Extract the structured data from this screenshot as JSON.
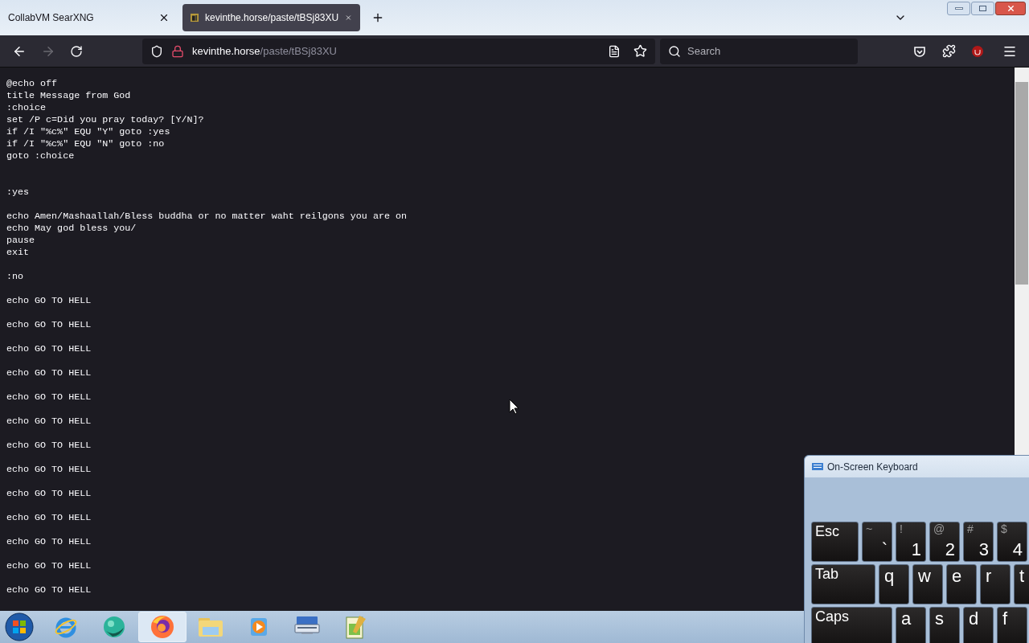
{
  "tabs": [
    {
      "title": "CollabVM SearXNG",
      "selected": false
    },
    {
      "title": "kevinthe.horse/paste/tBSj83XU",
      "selected": true
    }
  ],
  "address": {
    "domain": "kevinthe.horse",
    "path": "/paste/tBSj83XU"
  },
  "search": {
    "placeholder": "Search"
  },
  "code_lines": [
    {
      "kind": "text",
      "text": "@echo off"
    },
    {
      "kind": "text",
      "text": "title Message from God"
    },
    {
      "kind": "text",
      "text": ":choice"
    },
    {
      "kind": "text",
      "text": "set /P c=Did you pray today? [Y/N]?"
    },
    {
      "kind": "text",
      "text": "if /I \"%c%\" EQU \"Y\" goto :yes"
    },
    {
      "kind": "text",
      "text": "if /I \"%c%\" EQU \"N\" goto :no"
    },
    {
      "kind": "text",
      "text": "goto :choice"
    },
    {
      "kind": "blank"
    },
    {
      "kind": "blank"
    },
    {
      "kind": "text",
      "text": ":yes"
    },
    {
      "kind": "blank"
    },
    {
      "kind": "text",
      "text": "echo Amen/Mashaallah/Bless buddha or no matter waht reilgons you are on"
    },
    {
      "kind": "text",
      "text": "echo May god bless you/"
    },
    {
      "kind": "text",
      "text": "pause"
    },
    {
      "kind": "text",
      "text": "exit"
    },
    {
      "kind": "blank"
    },
    {
      "kind": "text",
      "text": ":no"
    },
    {
      "kind": "blank"
    },
    {
      "kind": "text",
      "text": "echo GO TO HELL"
    },
    {
      "kind": "blank"
    },
    {
      "kind": "text",
      "text": "echo GO TO HELL"
    },
    {
      "kind": "blank"
    },
    {
      "kind": "text",
      "text": "echo GO TO HELL"
    },
    {
      "kind": "blank"
    },
    {
      "kind": "text",
      "text": "echo GO TO HELL"
    },
    {
      "kind": "blank"
    },
    {
      "kind": "text",
      "text": "echo GO TO HELL"
    },
    {
      "kind": "blank"
    },
    {
      "kind": "text",
      "text": "echo GO TO HELL"
    },
    {
      "kind": "blank"
    },
    {
      "kind": "text",
      "text": "echo GO TO HELL"
    },
    {
      "kind": "blank"
    },
    {
      "kind": "text",
      "text": "echo GO TO HELL"
    },
    {
      "kind": "blank"
    },
    {
      "kind": "text",
      "text": "echo GO TO HELL"
    },
    {
      "kind": "blank"
    },
    {
      "kind": "text",
      "text": "echo GO TO HELL"
    },
    {
      "kind": "blank"
    },
    {
      "kind": "text",
      "text": "echo GO TO HELL"
    },
    {
      "kind": "blank"
    },
    {
      "kind": "text",
      "text": "echo GO TO HELL"
    },
    {
      "kind": "blank"
    },
    {
      "kind": "text",
      "text": "echo GO TO HELL"
    }
  ],
  "keyboard": {
    "title": "On-Screen Keyboard",
    "rows": [
      [
        {
          "label": "Esc",
          "kind": "wide"
        },
        {
          "label": "`",
          "shift": "~",
          "kind": "normal"
        },
        {
          "label": "1",
          "shift": "!",
          "kind": "normal"
        },
        {
          "label": "2",
          "shift": "@",
          "kind": "normal"
        },
        {
          "label": "3",
          "shift": "#",
          "kind": "normal"
        },
        {
          "label": "4",
          "shift": "$",
          "kind": "normal"
        }
      ],
      [
        {
          "label": "Tab",
          "kind": "wide"
        },
        {
          "label": "q",
          "kind": "normal"
        },
        {
          "label": "w",
          "kind": "normal"
        },
        {
          "label": "e",
          "kind": "normal"
        },
        {
          "label": "r",
          "kind": "normal"
        },
        {
          "label": "t",
          "kind": "normal"
        }
      ],
      [
        {
          "label": "Caps",
          "kind": "wide"
        },
        {
          "label": "a",
          "kind": "normal"
        },
        {
          "label": "s",
          "kind": "normal"
        },
        {
          "label": "d",
          "kind": "normal"
        },
        {
          "label": "f",
          "kind": "normal"
        }
      ]
    ]
  },
  "taskbar": [
    {
      "kind": "ie",
      "selected": false
    },
    {
      "kind": "globe",
      "selected": false
    },
    {
      "kind": "firefox",
      "selected": true
    },
    {
      "kind": "folder",
      "selected": false
    },
    {
      "kind": "media",
      "selected": false
    },
    {
      "kind": "keyboard",
      "selected": false
    },
    {
      "kind": "notepad",
      "selected": false
    }
  ]
}
